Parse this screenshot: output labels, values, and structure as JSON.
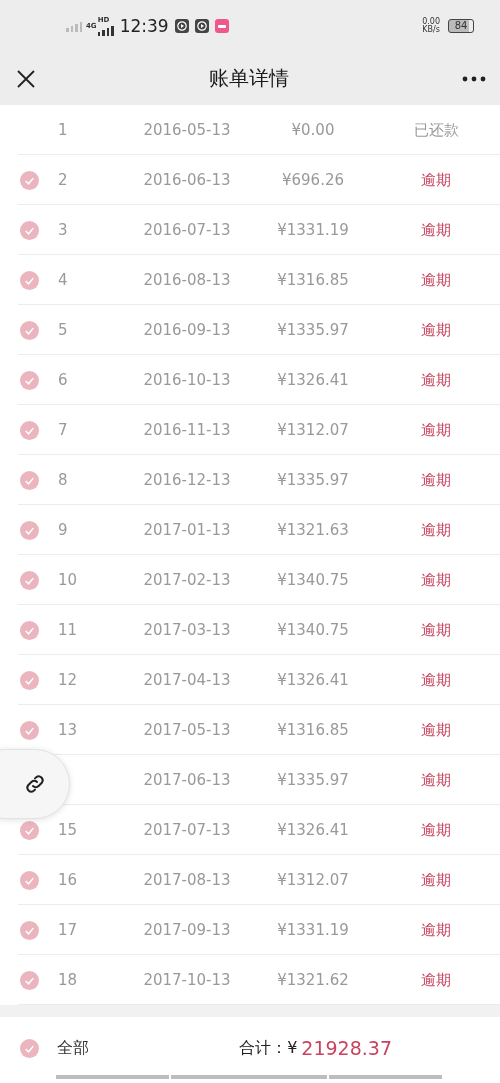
{
  "status_bar": {
    "network": "4G",
    "network_sub": "HD",
    "time": "12:39",
    "speed": "0.00",
    "speed_unit": "KB/s",
    "battery": "84"
  },
  "header": {
    "title": "账单详情"
  },
  "rows": [
    {
      "index": "1",
      "date": "2016-05-13",
      "amount": "¥0.00",
      "status": "已还款",
      "kind": "paid"
    },
    {
      "index": "2",
      "date": "2016-06-13",
      "amount": "¥696.26",
      "status": "逾期",
      "kind": "overdue",
      "checked": true
    },
    {
      "index": "3",
      "date": "2016-07-13",
      "amount": "¥1331.19",
      "status": "逾期",
      "kind": "overdue",
      "checked": true
    },
    {
      "index": "4",
      "date": "2016-08-13",
      "amount": "¥1316.85",
      "status": "逾期",
      "kind": "overdue",
      "checked": true
    },
    {
      "index": "5",
      "date": "2016-09-13",
      "amount": "¥1335.97",
      "status": "逾期",
      "kind": "overdue",
      "checked": true
    },
    {
      "index": "6",
      "date": "2016-10-13",
      "amount": "¥1326.41",
      "status": "逾期",
      "kind": "overdue",
      "checked": true
    },
    {
      "index": "7",
      "date": "2016-11-13",
      "amount": "¥1312.07",
      "status": "逾期",
      "kind": "overdue",
      "checked": true
    },
    {
      "index": "8",
      "date": "2016-12-13",
      "amount": "¥1335.97",
      "status": "逾期",
      "kind": "overdue",
      "checked": true
    },
    {
      "index": "9",
      "date": "2017-01-13",
      "amount": "¥1321.63",
      "status": "逾期",
      "kind": "overdue",
      "checked": true
    },
    {
      "index": "10",
      "date": "2017-02-13",
      "amount": "¥1340.75",
      "status": "逾期",
      "kind": "overdue",
      "checked": true
    },
    {
      "index": "11",
      "date": "2017-03-13",
      "amount": "¥1340.75",
      "status": "逾期",
      "kind": "overdue",
      "checked": true
    },
    {
      "index": "12",
      "date": "2017-04-13",
      "amount": "¥1326.41",
      "status": "逾期",
      "kind": "overdue",
      "checked": true
    },
    {
      "index": "13",
      "date": "2017-05-13",
      "amount": "¥1316.85",
      "status": "逾期",
      "kind": "overdue",
      "checked": true
    },
    {
      "date": "2017-06-13",
      "amount": "¥1335.97",
      "status": "逾期",
      "kind": "overdue"
    },
    {
      "index": "15",
      "date": "2017-07-13",
      "amount": "¥1326.41",
      "status": "逾期",
      "kind": "overdue",
      "checked": true
    },
    {
      "index": "16",
      "date": "2017-08-13",
      "amount": "¥1312.07",
      "status": "逾期",
      "kind": "overdue",
      "checked": true
    },
    {
      "index": "17",
      "date": "2017-09-13",
      "amount": "¥1331.19",
      "status": "逾期",
      "kind": "overdue",
      "checked": true
    },
    {
      "index": "18",
      "date": "2017-10-13",
      "amount": "¥1321.62",
      "status": "逾期",
      "kind": "overdue",
      "checked": true
    }
  ],
  "footer": {
    "select_all": {
      "label": "全部",
      "checked": true
    },
    "total_label": "合计：¥",
    "total": "21928.37"
  }
}
